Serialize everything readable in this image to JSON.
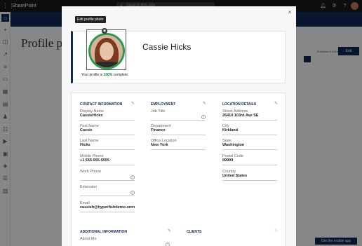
{
  "topbar": {
    "brand": "SharePoint",
    "search_placeholder": "Search this site"
  },
  "page": {
    "title": "Profile pro",
    "published": "Published 12/5/2018",
    "edit_label": "Edit",
    "app_button": "Get the mobile app"
  },
  "modal": {
    "tooltip": "Edit profile photo",
    "name": "Cassie Hicks",
    "complete_prefix": "Your profile is ",
    "complete_pct": "100%",
    "complete_suffix": " complete",
    "contact": {
      "title": "CONTACT INFORMATION",
      "display_name_label": "Display Name",
      "display_name": "CassieHicks",
      "first_name_label": "First Name",
      "first_name": "Cassie",
      "last_name_label": "Last Name",
      "last_name": "Hicks",
      "mobile_label": "Mobile Phone",
      "mobile": "+1 555-555-5555",
      "work_phone_label": "Work Phone",
      "extension_label": "Extension",
      "email_label": "Email",
      "email": "cassieh@hyperfishdemo.onmi..."
    },
    "employment": {
      "title": "EMPLOYMENT",
      "job_title_label": "Job Title",
      "department_label": "Department",
      "department": "Finance",
      "office_label": "Office Location",
      "office": "New York"
    },
    "location": {
      "title": "LOCATION DETAILS",
      "street_label": "Street Address",
      "street": "26410 103rd Ave SE",
      "city_label": "City",
      "city": "Kirkland",
      "state_label": "State",
      "state": "Washington",
      "postal_label": "Postal Code",
      "postal": "99999",
      "country_label": "Country",
      "country": "United States"
    },
    "additional": {
      "title": "ADDITIONAL INFORMATION",
      "about_label": "About Me"
    },
    "clients": {
      "title": "CLIENTS"
    }
  },
  "colors": {
    "accent": "#0f2a57",
    "photo_ring": "#2a9d4b",
    "complete": "#1a7a3a"
  }
}
